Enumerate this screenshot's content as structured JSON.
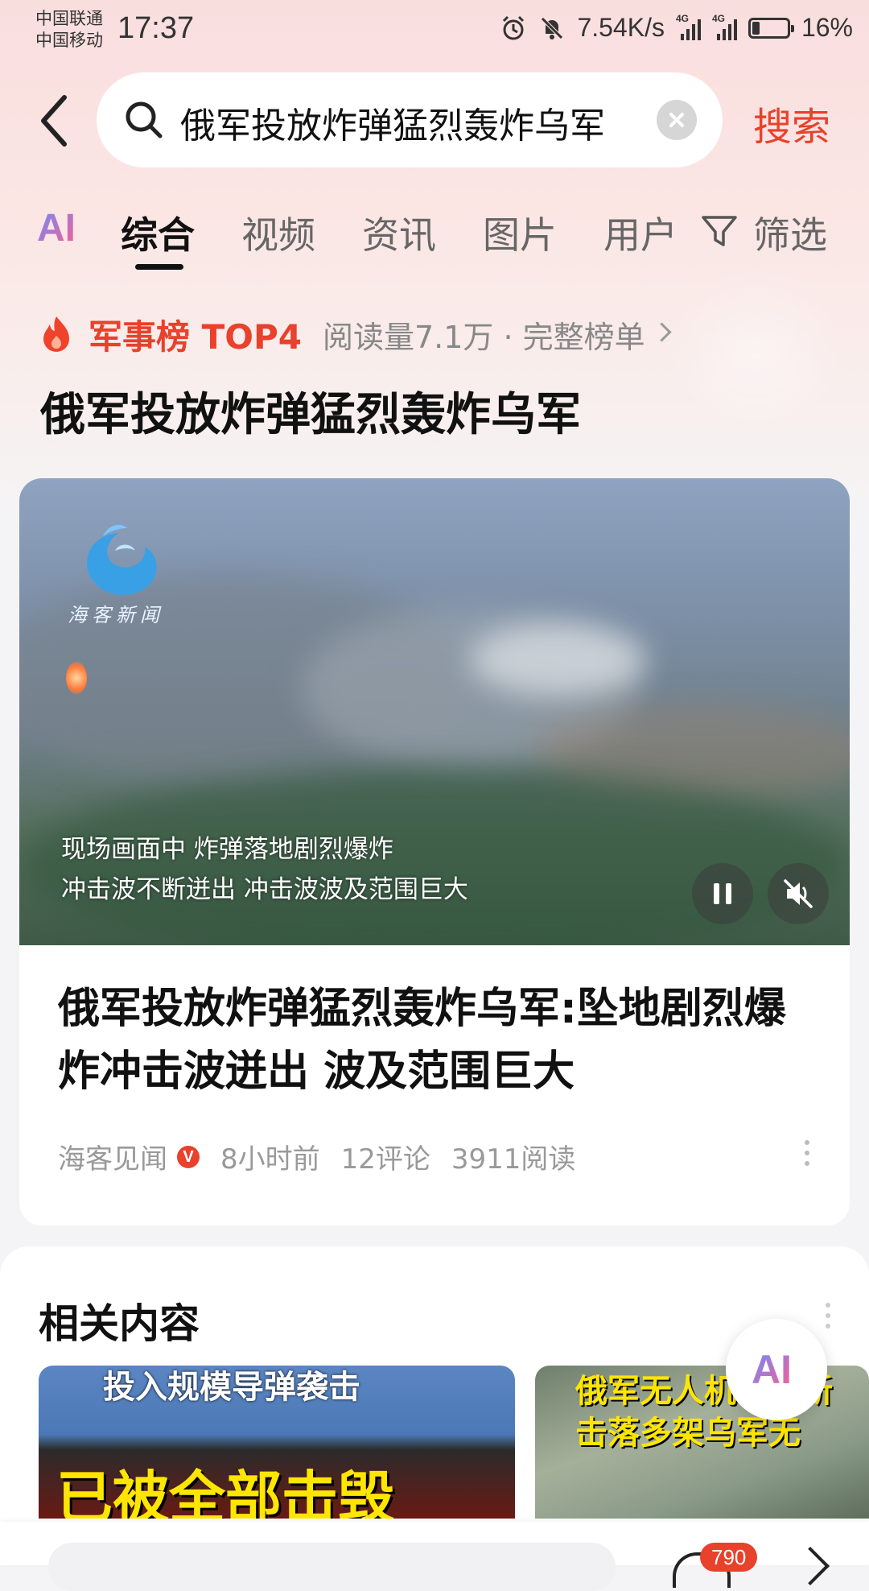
{
  "status_bar": {
    "carrier1": "中国联通",
    "carrier2": "中国移动",
    "time": "17:37",
    "net_speed": "7.54K/s",
    "network1": "4G",
    "network2": "4G",
    "battery": "16%",
    "icons": [
      "alarm-icon",
      "mute-icon",
      "signal-icon",
      "battery-charging-icon"
    ]
  },
  "search": {
    "query": "俄军投放炸弹猛烈轰炸乌军",
    "button": "搜索",
    "icons": [
      "back-icon",
      "search-icon",
      "clear-icon"
    ]
  },
  "tabs": {
    "ai": "AI",
    "items": [
      "综合",
      "视频",
      "资讯",
      "图片",
      "用户"
    ],
    "active": "综合",
    "filter": "筛选"
  },
  "hot_rank": {
    "label": "军事榜 TOP4",
    "meta": "阅读量7.1万 · 完整榜单",
    "topic": "俄军投放炸弹猛烈轰炸乌军"
  },
  "video_card": {
    "logo_text": "海客新闻",
    "subtitle_line1": "现场画面中  炸弹落地剧烈爆炸",
    "subtitle_line2": "冲击波不断迸出  冲击波波及范围巨大",
    "title": "俄军投放炸弹猛烈轰炸乌军:坠地剧烈爆炸冲击波迸出 波及范围巨大",
    "source": "海客见闻",
    "verified_badge": "V",
    "time": "8小时前",
    "comments": "12评论",
    "reads": "3911阅读"
  },
  "related": {
    "title": "相关内容",
    "thumb1_caption_top": "投入规模导弹袭击",
    "thumb1_caption_main": "已被全部击毁",
    "thumb2_caption": "俄军无人机利用新\n击落多架乌军无",
    "ai_button": "AI"
  },
  "bottom_bar": {
    "comment_count": "790"
  },
  "colors": {
    "accent": "#e8412c",
    "background_top": "#f9dede",
    "text_primary": "#111111",
    "text_secondary": "#999999"
  }
}
